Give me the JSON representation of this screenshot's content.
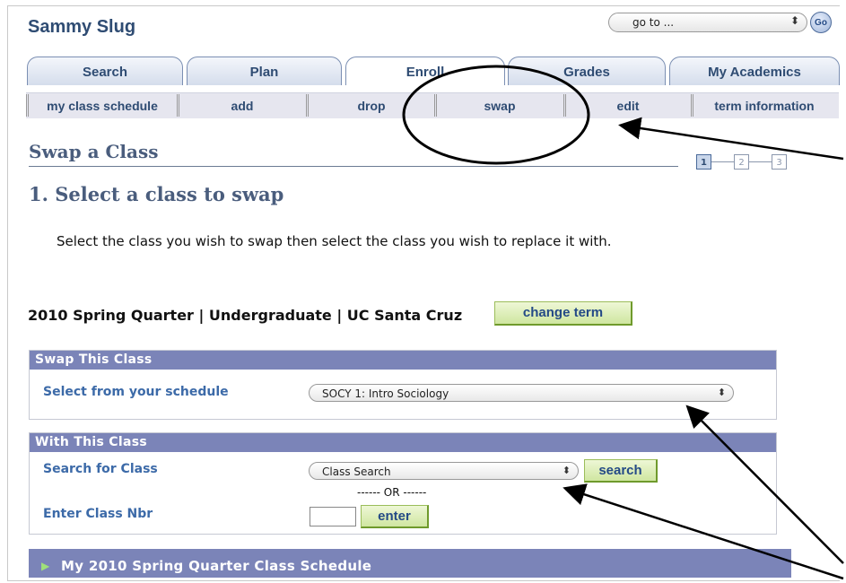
{
  "header": {
    "user_name": "Sammy Slug",
    "goto_value": "go to ...",
    "go_label": "Go"
  },
  "tabs": [
    {
      "label": "Search"
    },
    {
      "label": "Plan"
    },
    {
      "label": "Enroll"
    },
    {
      "label": "Grades"
    },
    {
      "label": "My Academics"
    }
  ],
  "subtabs": [
    {
      "label": "my class schedule"
    },
    {
      "label": "add"
    },
    {
      "label": "drop"
    },
    {
      "label": "swap"
    },
    {
      "label": "edit"
    },
    {
      "label": "term information"
    }
  ],
  "page": {
    "title": "Swap a Class",
    "steps": [
      "1",
      "2",
      "3"
    ],
    "heading": "1.  Select a class to swap",
    "instructions": "Select the class you wish to swap then select the class you wish to replace it with."
  },
  "term": {
    "text": "2010 Spring Quarter | Undergraduate | UC Santa Cruz",
    "change_label": "change term"
  },
  "swap_this": {
    "header": "Swap This Class",
    "label": "Select from your schedule",
    "selected": "SOCY 1: Intro Sociology"
  },
  "with_this": {
    "header": "With This Class",
    "search_label": "Search for Class",
    "search_selected": "Class Search",
    "search_button": "search",
    "or_text": "------ OR ------",
    "nbr_label": "Enter Class Nbr",
    "enter_button": "enter"
  },
  "schedule_bar": {
    "label": "My 2010 Spring Quarter Class Schedule"
  },
  "colors": {
    "header_bar": "#7b84b8",
    "title_text": "#4a5d7d",
    "label_text": "#3c6aa8",
    "button_green": "#cfe6a0"
  }
}
